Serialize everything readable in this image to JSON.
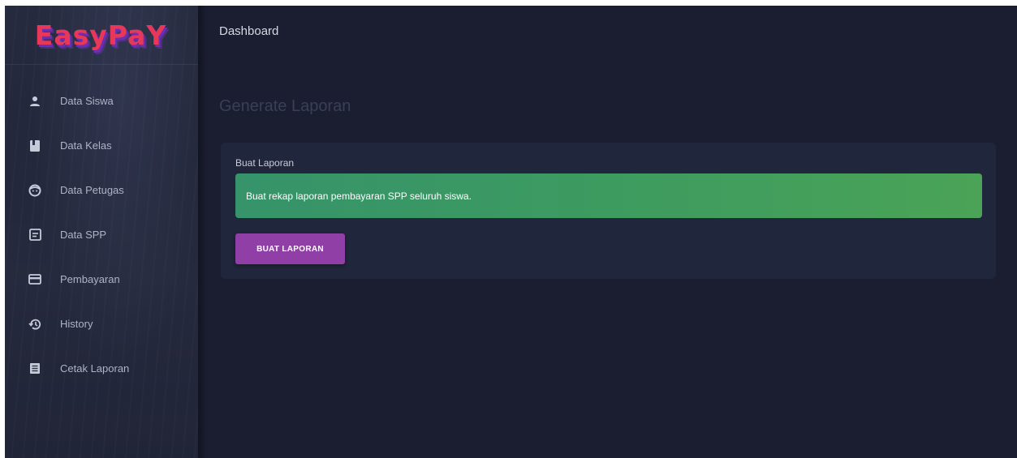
{
  "app": {
    "logo": "EasyPaY"
  },
  "sidebar": {
    "items": [
      {
        "label": "Data Siswa",
        "icon": "person-icon"
      },
      {
        "label": "Data Kelas",
        "icon": "book-icon"
      },
      {
        "label": "Data Petugas",
        "icon": "face-icon"
      },
      {
        "label": "Data SPP",
        "icon": "receipt-icon"
      },
      {
        "label": "Pembayaran",
        "icon": "credit-card-icon"
      },
      {
        "label": "History",
        "icon": "history-icon"
      },
      {
        "label": "Cetak Laporan",
        "icon": "document-icon"
      }
    ]
  },
  "header": {
    "title": "Dashboard"
  },
  "main": {
    "page_title": "Generate Laporan",
    "card": {
      "title": "Buat Laporan",
      "alert": "Buat rekap laporan pembayaran SPP seluruh siswa.",
      "button": "BUAT LAPORAN"
    }
  },
  "colors": {
    "background": "#1a1e30",
    "card": "#20263b",
    "alert_green": "#3d9b60",
    "button_purple": "#8f3fa5",
    "logo_red": "#e8385a"
  }
}
